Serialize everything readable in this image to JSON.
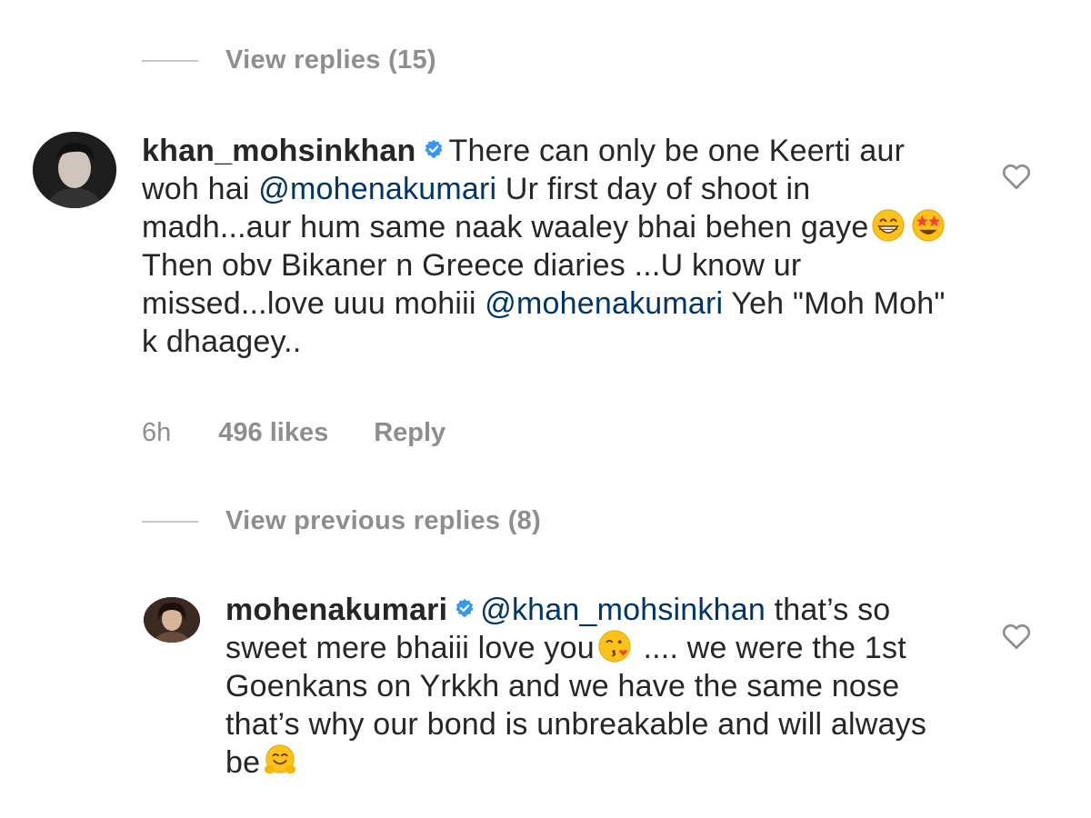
{
  "thread": {
    "view_replies_top": "View replies (15)",
    "view_previous_replies": "View previous replies (8)"
  },
  "comments": [
    {
      "username": "khan_mohsinkhan",
      "verified": true,
      "text_1": "There can only be one Keerti aur woh hai ",
      "mention_1": "@mohenakumari",
      "text_2": " Ur first day of shoot in madh...aur hum same naak waaley bhai behen gaye",
      "emoji_1": "beaming-face-emoji",
      "emoji_2": "star-struck-emoji",
      "text_3": " Then obv Bikaner n Greece diaries ...U know ur missed...love uuu mohiii ",
      "mention_2": "@mohenakumari",
      "text_4": " Yeh \"Moh Moh\" k dhaagey..",
      "time": "6h",
      "likes": "496 likes",
      "reply_label": "Reply",
      "like_icon": "heart-outline-icon"
    },
    {
      "username": "mohenakumari",
      "verified": true,
      "mention_1": "@khan_mohsinkhan",
      "text_1": " that’s so sweet mere bhaiii love you",
      "emoji_1": "face-blowing-kiss-emoji",
      "text_2": " .... we were the 1st Goenkans on Yrkkh and we have the same nose that’s why our bond is unbreakable and will always be",
      "emoji_2": "hugging-face-emoji",
      "like_icon": "heart-outline-icon"
    }
  ],
  "colors": {
    "text": "#262626",
    "meta": "#8e8e8e",
    "mention": "#003569",
    "verified": "#3897f0",
    "emoji_yellow": "#fcc21b"
  }
}
